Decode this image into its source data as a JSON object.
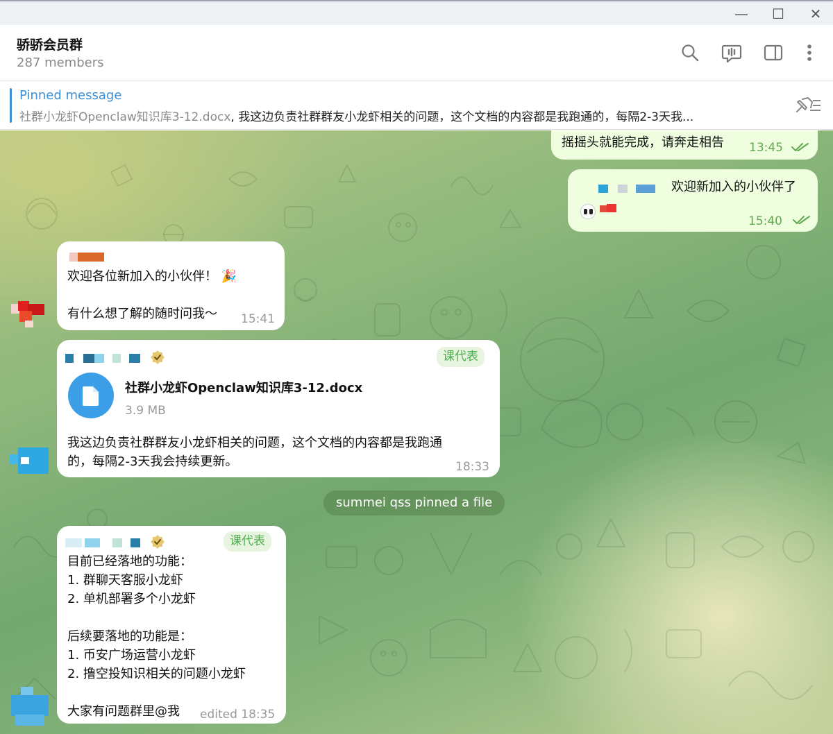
{
  "window": {
    "minimize_glyph": "—",
    "maximize_glyph": "☐",
    "close_glyph": "✕"
  },
  "header": {
    "title": "骄骄会员群",
    "members": "287 members",
    "icons": [
      "search-icon",
      "voice-chat-icon",
      "sidebar-toggle-icon",
      "more-icon"
    ]
  },
  "pinned": {
    "title": "Pinned message",
    "file_name": "社群小龙虾Openclaw知识库3-12.docx",
    "text": ", 我这边负责社群群友小龙虾相关的问题，这个文档的内容都是我跑通的，每隔2-3天我..."
  },
  "messages": {
    "m1": {
      "text": "摇摇头就能完成，请奔走相告",
      "time": "13:45"
    },
    "m2": {
      "text": "欢迎新加入的小伙伴了",
      "time": "15:40"
    },
    "m3": {
      "line1": "欢迎各位新加入的小伙伴！",
      "emoji": "🎉",
      "line2": "有什么想了解的随时问我～",
      "time": "15:41"
    },
    "m4": {
      "tag": "课代表",
      "file_name": "社群小龙虾Openclaw知识库3-12.docx",
      "file_size": "3.9 MB",
      "line1": "我这边负责社群群友小龙虾相关的问题，这个文档的内容都是我跑通",
      "line2": "的，每隔2-3天我会持续更新。",
      "time": "18:33"
    },
    "service": "summei qss pinned a file",
    "m5": {
      "tag": "课代表",
      "lines": [
        "目前已经落地的功能：",
        "1. 群聊天客服小龙虾",
        "2. 单机部署多个小龙虾",
        "",
        "后续要落地的功能是：",
        "1. 币安广场运营小龙虾",
        "2. 撸空投知识相关的问题小龙虾",
        "",
        "大家有问题群里@我"
      ],
      "time": "edited 18:35"
    }
  },
  "colors": {
    "accent": "#3a8fd6",
    "outgoing_bubble": "#eefedf",
    "check_green": "#62a851",
    "admin_tag": "#4fae4e"
  }
}
